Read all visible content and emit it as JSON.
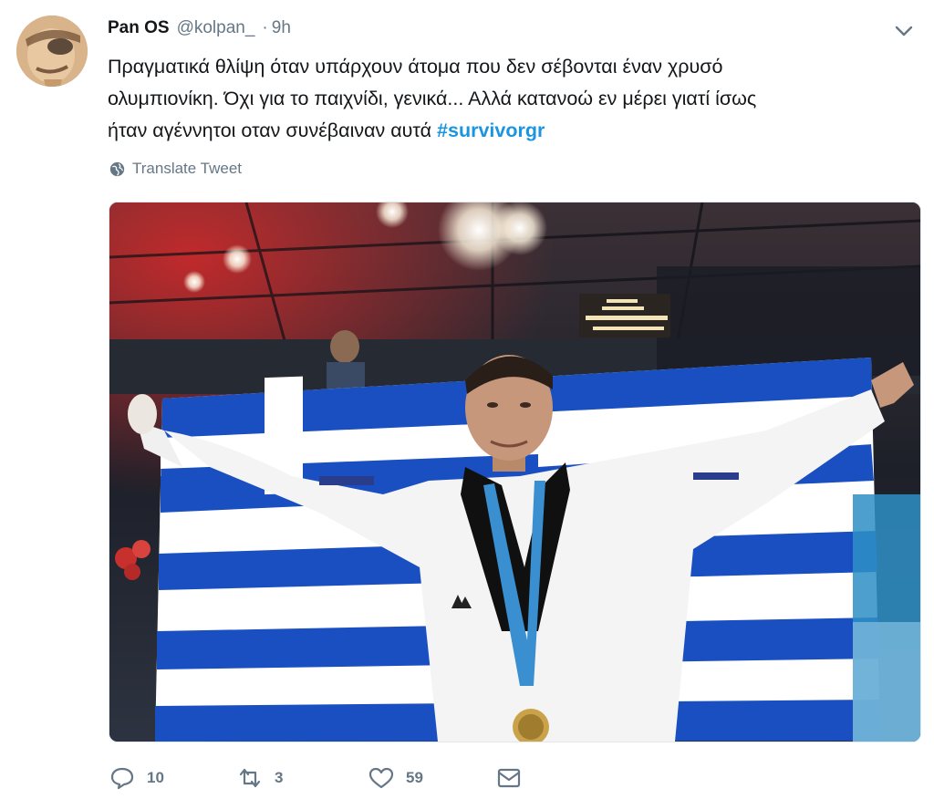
{
  "tweet": {
    "author_name": "Pan OS",
    "handle": "@kolpan_",
    "separator": "·",
    "time": "9h",
    "text_lines": [
      "Πραγματικά θλίψη όταν υπάρχουν άτομα που δεν σέβονται έναν χρυσό",
      "ολυμπιονίκη. Όχι για το παιχνίδι, γενικά... Αλλά κατανοώ εν μέρει γιατί ίσως",
      "ήταν αγέννητοι οταν συνέβαιναν αυτά "
    ],
    "hashtag": "#survivorgr",
    "translate_label": "Translate Tweet"
  },
  "media": {
    "description_icon": "photo"
  },
  "actions": {
    "reply_count": "10",
    "retweet_count": "3",
    "like_count": "59"
  },
  "colors": {
    "text": "#14171a",
    "muted": "#657786",
    "link": "#1b95e0",
    "flag_blue": "#1a4fc2"
  }
}
